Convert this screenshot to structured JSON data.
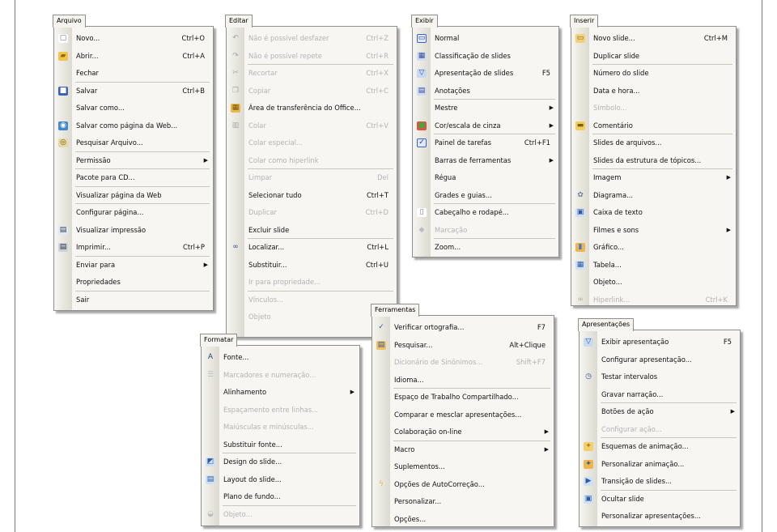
{
  "menus": {
    "arquivo": {
      "title": "Arquivo",
      "items": [
        {
          "label": "Novo...",
          "sc": "Ctrl+O",
          "icon": "new-icon"
        },
        {
          "label": "Abrir...",
          "sc": "Ctrl+A",
          "icon": "open-folder-icon"
        },
        {
          "label": "Fechar",
          "sep": true
        },
        {
          "label": "Salvar",
          "sc": "Ctrl+B",
          "icon": "save-icon"
        },
        {
          "label": "Salvar como..."
        },
        {
          "label": "Salvar como página da Web...",
          "icon": "save-web-icon"
        },
        {
          "label": "Pesquisar Arquivo...",
          "sep": true,
          "icon": "search-file-icon"
        },
        {
          "label": "Permissão",
          "arrow": true,
          "sep": true
        },
        {
          "label": "Pacote para CD...",
          "sep": true
        },
        {
          "label": "Visualizar página da Web",
          "sep": true
        },
        {
          "label": "Configurar página..."
        },
        {
          "label": "Visualizar impressão",
          "icon": "print-preview-icon"
        },
        {
          "label": "Imprimir...",
          "sc": "Ctrl+P",
          "sep": true,
          "icon": "print-icon"
        },
        {
          "label": "Enviar para",
          "arrow": true
        },
        {
          "label": "Propriedades",
          "sep": true
        },
        {
          "label": "Sair"
        }
      ]
    },
    "editar": {
      "title": "Editar",
      "items": [
        {
          "label": "Não é possível desfazer",
          "sc": "Ctrl+Z",
          "dis": true,
          "icon": "undo-icon"
        },
        {
          "label": "Não é possível repete",
          "sc": "Ctrl+R",
          "dis": true,
          "sep": true,
          "icon": "redo-icon"
        },
        {
          "label": "Recortar",
          "sc": "Ctrl+X",
          "dis": true,
          "icon": "cut-icon"
        },
        {
          "label": "Copiar",
          "sc": "Ctrl+C",
          "dis": true,
          "icon": "copy-icon"
        },
        {
          "label": "Área de transferência do Office...",
          "icon": "clipboard-icon"
        },
        {
          "label": "Colar",
          "sc": "Ctrl+V",
          "dis": true,
          "icon": "paste-icon"
        },
        {
          "label": "Colar especial...",
          "dis": true
        },
        {
          "label": "Colar como hiperlink",
          "dis": true,
          "sep": true
        },
        {
          "label": "Limpar",
          "sc": "Del",
          "dis": true
        },
        {
          "label": "Selecionar tudo",
          "sc": "Ctrl+T"
        },
        {
          "label": "Duplicar",
          "sc": "Ctrl+D",
          "dis": true
        },
        {
          "label": "Excluir slide",
          "sep": true
        },
        {
          "label": "Localizar...",
          "sc": "Ctrl+L",
          "icon": "binoculars-icon"
        },
        {
          "label": "Substituir...",
          "sc": "Ctrl+U"
        },
        {
          "label": "Ir para propriedade...",
          "dis": true,
          "sep": true
        },
        {
          "label": "Vínculos...",
          "dis": true
        },
        {
          "label": "Objeto",
          "dis": true
        }
      ]
    },
    "exibir": {
      "title": "Exibir",
      "items": [
        {
          "label": "Normal",
          "icon": "normal-view-icon",
          "checked": true
        },
        {
          "label": "Classificação de slides",
          "icon": "slide-sorter-icon"
        },
        {
          "label": "Apresentação de slides",
          "sc": "F5",
          "icon": "slideshow-icon"
        },
        {
          "label": "Anotações",
          "sep": true,
          "icon": "notes-icon"
        },
        {
          "label": "Mestre",
          "arrow": true
        },
        {
          "label": "Cor/escala de cinza",
          "arrow": true,
          "sep": true,
          "icon": "color-icon"
        },
        {
          "label": "Painel de tarefas",
          "sc": "Ctrl+F1",
          "icon": "check-icon",
          "checked": true
        },
        {
          "label": "Barras de ferramentas",
          "arrow": true
        },
        {
          "label": "Régua"
        },
        {
          "label": "Grades e guias...",
          "sep": true
        },
        {
          "label": "Cabeçalho e rodapé...",
          "icon": "header-footer-icon"
        },
        {
          "label": "Marcação",
          "dis": true,
          "sep": true,
          "icon": "markup-icon"
        },
        {
          "label": "Zoom..."
        }
      ]
    },
    "inserir": {
      "title": "Inserir",
      "items": [
        {
          "label": "Novo slide...",
          "sc": "Ctrl+M",
          "icon": "new-slide-icon"
        },
        {
          "label": "Duplicar slide",
          "sep": true
        },
        {
          "label": "Número do slide"
        },
        {
          "label": "Data e hora..."
        },
        {
          "label": "Símbolo...",
          "dis": true
        },
        {
          "label": "Comentário",
          "sep": true,
          "icon": "comment-icon"
        },
        {
          "label": "Slides de arquivos..."
        },
        {
          "label": "Slides da estrutura de tópicos...",
          "sep": true
        },
        {
          "label": "Imagem",
          "arrow": true
        },
        {
          "label": "Diagrama...",
          "icon": "diagram-icon"
        },
        {
          "label": "Caixa de texto",
          "icon": "textbox-icon"
        },
        {
          "label": "Filmes e sons",
          "arrow": true
        },
        {
          "label": "Gráfico...",
          "icon": "chart-icon"
        },
        {
          "label": "Tabela...",
          "icon": "table-icon"
        },
        {
          "label": "Objeto..."
        },
        {
          "label": "Hiperlink...",
          "sc": "Ctrl+K",
          "dis": true,
          "icon": "hyperlink-icon"
        }
      ]
    },
    "formatar": {
      "title": "Formatar",
      "items": [
        {
          "label": "Fonte...",
          "icon": "font-icon"
        },
        {
          "label": "Marcadores e numeração...",
          "dis": true,
          "icon": "bullets-icon"
        },
        {
          "label": "Alinhamento",
          "arrow": true
        },
        {
          "label": "Espaçamento entre linhas...",
          "dis": true
        },
        {
          "label": "Maiúsculas e minúsculas...",
          "dis": true
        },
        {
          "label": "Substituir fonte...",
          "sep": true
        },
        {
          "label": "Design do slide...",
          "icon": "design-icon"
        },
        {
          "label": "Layout do slide...",
          "icon": "layout-icon"
        },
        {
          "label": "Plano de fundo...",
          "sep": true
        },
        {
          "label": "Objeto...",
          "dis": true,
          "icon": "object-icon"
        }
      ]
    },
    "ferramentas": {
      "title": "Ferramentas",
      "items": [
        {
          "label": "Verificar ortografia...",
          "sc": "F7",
          "icon": "spelling-icon"
        },
        {
          "label": "Pesquisar...",
          "sc": "Alt+Clique",
          "icon": "research-icon"
        },
        {
          "label": "Dicionário de Sinônimos...",
          "sc": "Shift+F7",
          "dis": true
        },
        {
          "label": "Idioma...",
          "sep": true
        },
        {
          "label": "Espaço de Trabalho Compartilhado..."
        },
        {
          "label": "Comparar e mesclar apresentações..."
        },
        {
          "label": "Colaboração on-line",
          "arrow": true,
          "sep": true
        },
        {
          "label": "Macro",
          "arrow": true
        },
        {
          "label": "Suplementos..."
        },
        {
          "label": "Opções de AutoCorreção...",
          "icon": "autocorrect-icon"
        },
        {
          "label": "Personalizar..."
        },
        {
          "label": "Opções..."
        }
      ]
    },
    "apresentacoes": {
      "title": "Apresentações",
      "items": [
        {
          "label": "Exibir apresentação",
          "sc": "F5",
          "icon": "slideshow-icon"
        },
        {
          "label": "Configurar apresentação..."
        },
        {
          "label": "Testar intervalos",
          "icon": "rehearse-icon"
        },
        {
          "label": "Gravar narração...",
          "sep": true
        },
        {
          "label": "Botões de ação",
          "arrow": true
        },
        {
          "label": "Configurar ação...",
          "dis": true,
          "sep": true
        },
        {
          "label": "Esquemas de animação...",
          "icon": "animation-scheme-icon"
        },
        {
          "label": "Personalizar animação...",
          "icon": "custom-animation-icon"
        },
        {
          "label": "Transição de slides...",
          "sep": true,
          "icon": "transition-icon"
        },
        {
          "label": "Ocultar slide",
          "icon": "hide-slide-icon"
        },
        {
          "label": "Personalizar apresentações..."
        }
      ]
    }
  }
}
